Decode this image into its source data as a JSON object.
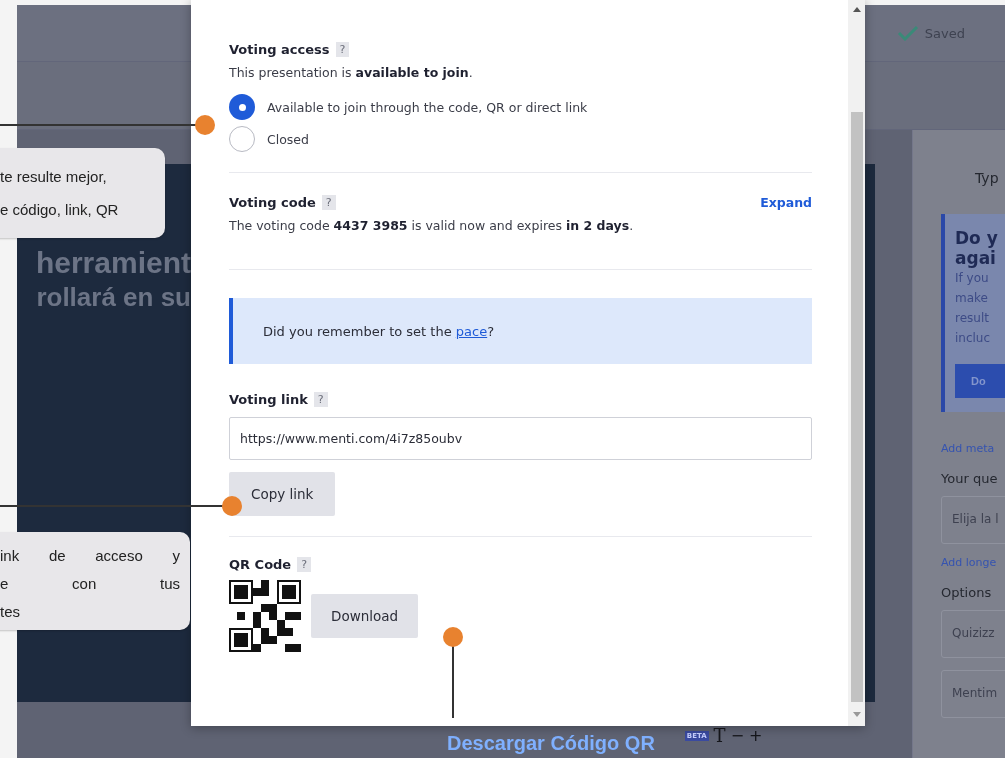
{
  "app": {
    "status": "Saved",
    "slide_lines": [
      "herramient",
      "rollará en su"
    ],
    "slide_caption": "Descargar Código QR",
    "toolbar": {
      "badge": "BETA",
      "font_glyph": "T",
      "minus": "−",
      "plus": "+"
    },
    "sidebar": [
      {
        "kind": "heading",
        "text": "Typ"
      },
      {
        "kind": "notice",
        "title_lines": [
          "Do y",
          "agai"
        ],
        "body_lines": [
          "If you",
          "make",
          "result",
          "incluc"
        ],
        "button": "Do"
      },
      {
        "kind": "link",
        "text": "Add meta"
      },
      {
        "kind": "label",
        "text": "Your que"
      },
      {
        "kind": "field",
        "text": "Elija la l"
      },
      {
        "kind": "link",
        "text": "Add longe"
      },
      {
        "kind": "label",
        "text": "Options"
      },
      {
        "kind": "field",
        "text": "Quizizz"
      },
      {
        "kind": "field",
        "text": "Mentim"
      }
    ]
  },
  "dialog": {
    "access": {
      "title": "Voting access",
      "help": "?",
      "status": "This presentation is **available to join**.",
      "options": [
        {
          "label": "Available to join through the code, QR or direct link",
          "selected": true
        },
        {
          "label": "Closed",
          "selected": false
        }
      ]
    },
    "code": {
      "title": "Voting code",
      "help": "?",
      "action": "Expand",
      "text": "The voting code **4437 3985** is valid now and expires **in 2 days**."
    },
    "notice": {
      "before": "Did you remember to set the ",
      "link": "pace",
      "after": "?"
    },
    "link": {
      "title": "Voting link",
      "help": "?",
      "url": "https://www.menti.com/4i7z85oubv",
      "button": "Copy link"
    },
    "qr": {
      "title": "QR Code",
      "help": "?",
      "button": "Download"
    }
  },
  "annotations": [
    {
      "lines": [
        "te resulte mejor,",
        "e código, link, QR"
      ],
      "justify": false
    },
    {
      "lines": [
        "ink de acceso y",
        "e con tus",
        "tes"
      ],
      "justify": true
    }
  ]
}
